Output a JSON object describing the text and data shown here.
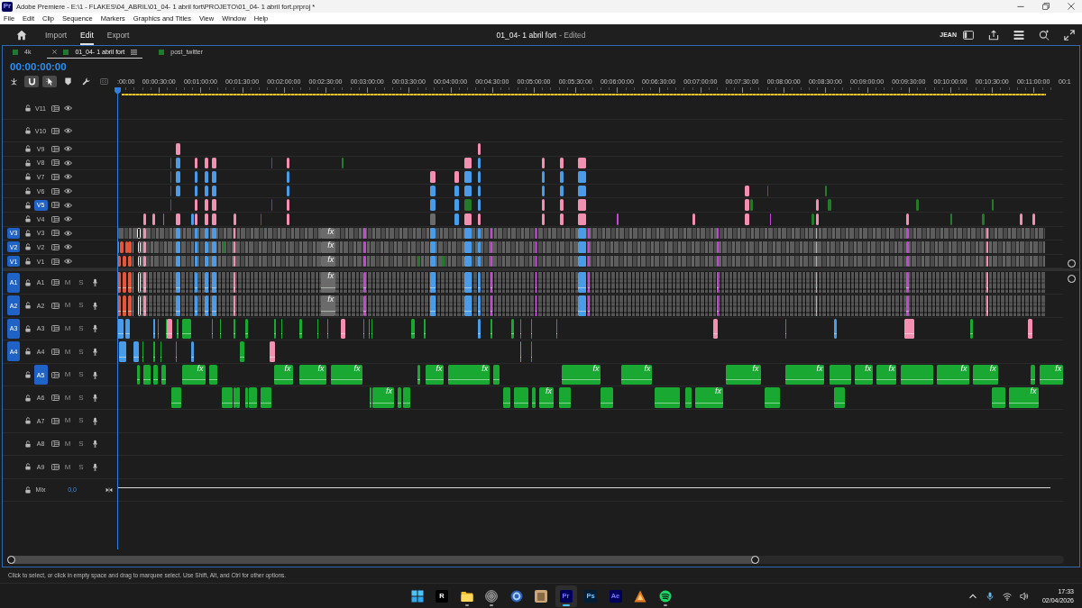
{
  "window": {
    "app_icon": "Pr",
    "title": "Adobe Premiere - E:\\1 - FLAKES\\04_ABRIL\\01_04- 1 abril fort\\PROJETO\\01_04- 1 abril fort.prproj *"
  },
  "menu": [
    "File",
    "Edit",
    "Clip",
    "Sequence",
    "Markers",
    "Graphics and Titles",
    "View",
    "Window",
    "Help"
  ],
  "header": {
    "tabs": [
      {
        "label": "Import",
        "selected": false
      },
      {
        "label": "Edit",
        "selected": true
      },
      {
        "label": "Export",
        "selected": false
      }
    ],
    "project": "01_04- 1 abril fort",
    "status": "- Edited",
    "workspace": "JEAN"
  },
  "sequence_tabs": [
    {
      "label": "4k",
      "selected": false
    },
    {
      "label": "01_04- 1 abril fort",
      "selected": true
    },
    {
      "label": "post_twitter",
      "selected": false
    }
  ],
  "timecode": "00:00:00:00",
  "tools": [
    {
      "kind": "nest",
      "on": false
    },
    {
      "kind": "snap",
      "on": true
    },
    {
      "kind": "linked",
      "on": true
    },
    {
      "kind": "marker",
      "on": false
    },
    {
      "kind": "wrench",
      "on": false
    },
    {
      "kind": "captions",
      "on": false
    }
  ],
  "ruler": {
    "labels": [
      ":00:00",
      "00:00:30:00",
      "00:01:00:00",
      "00:01:30:00",
      "00:02:00:00",
      "00:02:30:00",
      "00:03:00:00",
      "00:03:30:00",
      "00:04:00:00",
      "00:04:30:00",
      "00:05:00:00",
      "00:05:30:00",
      "00:06:00:00",
      "00:06:30:00",
      "00:07:00:00",
      "00:07:30:00",
      "00:08:00:00",
      "00:08:30:00",
      "00:09:00:00",
      "00:09:30:00",
      "00:10:00:00",
      "00:10:30:00",
      "00:11:00:00",
      "00:1"
    ]
  },
  "video_tracks": [
    {
      "name": "V11",
      "expanded": true,
      "targeted": false,
      "locked": false,
      "visible": true
    },
    {
      "name": "V10",
      "expanded": true,
      "targeted": false,
      "locked": false,
      "visible": true
    },
    {
      "name": "V9",
      "expanded": false,
      "targeted": false,
      "locked": false,
      "visible": true,
      "clips": [
        {
          "kind": "clip",
          "color": "#f48fb1"
        },
        {
          "kind": "clip",
          "color": "#f48fb1"
        }
      ]
    },
    {
      "name": "V8",
      "expanded": false,
      "targeted": false,
      "locked": false,
      "visible": true,
      "clips": [
        {
          "kind": "clip",
          "color": "#237a2a"
        },
        {
          "kind": "clip",
          "color": "#4a9be8"
        },
        {
          "kind": "clip",
          "color": "#f48fb1"
        },
        {
          "kind": "clip",
          "color": "#f48fb1"
        },
        {
          "kind": "clip",
          "color": "#f48fb1"
        },
        {
          "kind": "clip",
          "color": "#237a2a"
        },
        {
          "kind": "clip",
          "color": "#f48fb1"
        },
        {
          "kind": "clip",
          "color": "#237a2a"
        },
        {
          "kind": "clip",
          "color": "#f48fb1"
        },
        {
          "kind": "clip",
          "color": "#4a9be8"
        },
        {
          "kind": "clip",
          "color": "#f48fb1"
        },
        {
          "kind": "clip",
          "color": "#f48fb1"
        },
        {
          "kind": "clip",
          "color": "#f48fb1"
        }
      ]
    },
    {
      "name": "V7",
      "expanded": false,
      "targeted": false,
      "locked": false,
      "visible": true,
      "clips": [
        {
          "kind": "clip",
          "color": "#237a2a"
        },
        {
          "kind": "clip",
          "color": "#4a9be8"
        },
        {
          "kind": "clip",
          "color": "#4a9be8"
        },
        {
          "kind": "clip",
          "color": "#4a9be8"
        },
        {
          "kind": "clip",
          "color": "#4a9be8"
        },
        {
          "kind": "clip",
          "color": "#4a9be8"
        },
        {
          "kind": "clip",
          "color": "#f48fb1"
        },
        {
          "kind": "clip",
          "color": "#f48fb1"
        },
        {
          "kind": "clip",
          "color": "#4a9be8"
        },
        {
          "kind": "clip",
          "color": "#4a9be8"
        },
        {
          "kind": "clip",
          "color": "#4a9be8"
        },
        {
          "kind": "clip",
          "color": "#4a9be8"
        },
        {
          "kind": "clip",
          "color": "#4a9be8"
        }
      ]
    },
    {
      "name": "V6",
      "expanded": false,
      "targeted": false,
      "locked": false,
      "visible": true,
      "clips": [
        {
          "kind": "clip",
          "color": "#237a2a"
        },
        {
          "kind": "clip",
          "color": "#4a9be8"
        },
        {
          "kind": "clip",
          "color": "#4a9be8"
        },
        {
          "kind": "clip",
          "color": "#4a9be8"
        },
        {
          "kind": "clip",
          "color": "#4a9be8"
        },
        {
          "kind": "clip",
          "color": "#4a9be8"
        },
        {
          "kind": "clip",
          "color": "#4a9be8"
        },
        {
          "kind": "clip",
          "color": "#4a9be8"
        },
        {
          "kind": "clip",
          "color": "#4a9be8"
        },
        {
          "kind": "clip",
          "color": "#4a9be8"
        },
        {
          "kind": "clip",
          "color": "#4a9be8"
        },
        {
          "kind": "clip",
          "color": "#4a9be8"
        },
        {
          "kind": "clip",
          "color": "#4a9be8"
        },
        {
          "kind": "clip",
          "color": "#f48fb1"
        },
        {
          "kind": "clip",
          "color": "#237a2a"
        },
        {
          "kind": "clip",
          "color": "#237a2a"
        }
      ]
    },
    {
      "name": "V5",
      "expanded": false,
      "targeted": true,
      "locked": false,
      "visible": true,
      "clips": [
        {
          "kind": "clip",
          "color": "#237a2a"
        },
        {
          "kind": "clip",
          "color": "#f48fb1"
        },
        {
          "kind": "clip",
          "color": "#f48fb1"
        },
        {
          "kind": "clip",
          "color": "#f48fb1"
        },
        {
          "kind": "clip",
          "color": "#237a2a"
        },
        {
          "kind": "clip",
          "color": "#f48fb1"
        },
        {
          "kind": "clip",
          "color": "#4a9be8"
        },
        {
          "kind": "clip",
          "color": "#4a9be8"
        },
        {
          "kind": "clip",
          "color": "#237a2a"
        },
        {
          "kind": "clip",
          "color": "#4a9be8"
        },
        {
          "kind": "clip",
          "color": "#f48fb1"
        },
        {
          "kind": "clip",
          "color": "#f48fb1"
        },
        {
          "kind": "clip",
          "color": "#f48fb1"
        },
        {
          "kind": "clip",
          "color": "#f48fb1"
        },
        {
          "kind": "clip",
          "color": "#237a2a"
        },
        {
          "kind": "clip",
          "color": "#f48fb1"
        },
        {
          "kind": "clip",
          "color": "#237a2a"
        },
        {
          "kind": "clip",
          "color": "#237a2a"
        },
        {
          "kind": "clip",
          "color": "#237a2a"
        }
      ]
    },
    {
      "name": "V4",
      "expanded": false,
      "targeted": false,
      "locked": false,
      "visible": true,
      "clips": [
        {
          "kind": "clip",
          "color": "#f48fb1"
        },
        {
          "kind": "clip",
          "color": "#f48fb1"
        },
        {
          "kind": "clip",
          "color": "#c646d6"
        },
        {
          "kind": "clip",
          "color": "#f48fb1"
        },
        {
          "kind": "clip",
          "color": "#4a9be8"
        },
        {
          "kind": "clip",
          "color": "#f48fb1"
        },
        {
          "kind": "clip",
          "color": "#f48fb1"
        },
        {
          "kind": "clip",
          "color": "#f48fb1"
        },
        {
          "kind": "clip",
          "color": "#f48fb1"
        },
        {
          "kind": "clip",
          "color": "#237a2a"
        },
        {
          "kind": "clip",
          "color": "#f48fb1"
        },
        {
          "kind": "clip",
          "color": "#6b6b6b"
        },
        {
          "kind": "clip",
          "color": "#4a9be8"
        },
        {
          "kind": "clip",
          "color": "#f48fb1"
        },
        {
          "kind": "clip",
          "color": "#f48fb1"
        },
        {
          "kind": "clip",
          "color": "#f48fb1"
        },
        {
          "kind": "clip",
          "color": "#f48fb1"
        },
        {
          "kind": "clip",
          "color": "#f48fb1"
        },
        {
          "kind": "clip",
          "color": "#c646d6"
        },
        {
          "kind": "clip",
          "color": "#f48fb1"
        },
        {
          "kind": "clip",
          "color": "#f48fb1"
        },
        {
          "kind": "clip",
          "color": "#c646d6"
        },
        {
          "kind": "clip",
          "color": "#237a2a"
        },
        {
          "kind": "clip",
          "color": "#f48fb1"
        },
        {
          "kind": "clip",
          "color": "#f48fb1"
        },
        {
          "kind": "clip",
          "color": "#237a2a"
        },
        {
          "kind": "clip",
          "color": "#237a2a"
        },
        {
          "kind": "clip",
          "color": "#f48fb1"
        },
        {
          "kind": "clip",
          "color": "#f48fb1"
        }
      ]
    },
    {
      "name": "V3",
      "source": "V3",
      "expanded": false,
      "targeted": false,
      "locked": false,
      "visible": true,
      "clips": [
        {
          "kind": "clip",
          "color": "#237a2a"
        },
        {
          "kind": "run"
        },
        {
          "kind": "outline"
        },
        {
          "kind": "clip",
          "color": "#f48fb1"
        },
        {
          "kind": "clip",
          "color": "#4a9be8"
        },
        {
          "kind": "clip",
          "color": "#4a9be8"
        },
        {
          "kind": "clip",
          "color": "#4a9be8"
        },
        {
          "kind": "clip",
          "color": "#4a9be8"
        },
        {
          "kind": "clip",
          "color": "#f48fb1"
        },
        {
          "kind": "clip",
          "color": "#6b6b6b",
          "label": "fx"
        },
        {
          "kind": "clip",
          "color": "#c646d6"
        },
        {
          "kind": "clip",
          "color": "#4a9be8"
        },
        {
          "kind": "clip",
          "color": "#4a9be8"
        },
        {
          "kind": "clip",
          "color": "#4a9be8"
        },
        {
          "kind": "clip",
          "color": "#c646d6"
        },
        {
          "kind": "clip",
          "color": "#c646d6"
        },
        {
          "kind": "clip",
          "color": "#4a9be8"
        },
        {
          "kind": "clip",
          "color": "#c646d6"
        },
        {
          "kind": "clip",
          "color": "#c646d6"
        },
        {
          "kind": "clip",
          "color": "#f48fb1"
        },
        {
          "kind": "clip",
          "color": "#c646d6"
        },
        {
          "kind": "clip",
          "color": "#f48fb1"
        }
      ]
    },
    {
      "name": "V2",
      "source": "V2",
      "expanded": false,
      "targeted": false,
      "locked": false,
      "visible": true,
      "clips": [
        {
          "kind": "clip",
          "color": "#c646d6"
        },
        {
          "kind": "clip",
          "color": "#e8543a"
        },
        {
          "kind": "clip",
          "color": "#e8543a"
        },
        {
          "kind": "clip",
          "color": "#e8543a"
        },
        {
          "kind": "clip",
          "color": "#4a9be8"
        },
        {
          "kind": "outline"
        },
        {
          "kind": "run"
        },
        {
          "kind": "clip",
          "color": "#f48fb1"
        },
        {
          "kind": "clip",
          "color": "#4a9be8"
        },
        {
          "kind": "clip",
          "color": "#4a9be8"
        },
        {
          "kind": "clip",
          "color": "#4a9be8"
        },
        {
          "kind": "clip",
          "color": "#4a9be8"
        },
        {
          "kind": "clip",
          "color": "#237a2a"
        },
        {
          "kind": "clip",
          "color": "#f48fb1"
        },
        {
          "kind": "clip",
          "color": "#6b6b6b",
          "label": "fx"
        },
        {
          "kind": "clip",
          "color": "#c646d6"
        },
        {
          "kind": "clip",
          "color": "#4a9be8"
        },
        {
          "kind": "clip",
          "color": "#4a9be8"
        },
        {
          "kind": "clip",
          "color": "#4a9be8"
        },
        {
          "kind": "clip",
          "color": "#c646d6"
        },
        {
          "kind": "clip",
          "color": "#c646d6"
        },
        {
          "kind": "clip",
          "color": "#4a9be8"
        },
        {
          "kind": "clip",
          "color": "#c646d6"
        },
        {
          "kind": "clip",
          "color": "#c646d6"
        },
        {
          "kind": "clip",
          "color": "#f48fb1"
        },
        {
          "kind": "clip",
          "color": "#c646d6"
        },
        {
          "kind": "clip",
          "color": "#f48fb1"
        }
      ]
    },
    {
      "name": "V1",
      "source": "V1",
      "expanded": false,
      "targeted": false,
      "locked": false,
      "visible": true,
      "clips": [
        {
          "kind": "clip",
          "color": "#e8543a"
        },
        {
          "kind": "clip",
          "color": "#e8543a"
        },
        {
          "kind": "clip",
          "color": "#e8543a"
        },
        {
          "kind": "clip",
          "color": "#4a9be8"
        },
        {
          "kind": "outline"
        },
        {
          "kind": "run"
        },
        {
          "kind": "clip",
          "color": "#f48fb1"
        },
        {
          "kind": "clip",
          "color": "#4a9be8"
        },
        {
          "kind": "clip",
          "color": "#4a9be8"
        },
        {
          "kind": "clip",
          "color": "#4a9be8"
        },
        {
          "kind": "clip",
          "color": "#4a9be8"
        },
        {
          "kind": "clip",
          "color": "#f48fb1"
        },
        {
          "kind": "clip",
          "color": "#6b6b6b",
          "label": "fx"
        },
        {
          "kind": "clip",
          "color": "#c646d6"
        },
        {
          "kind": "clip",
          "color": "#237a2a"
        },
        {
          "kind": "clip",
          "color": "#237a2a"
        },
        {
          "kind": "clip",
          "color": "#4a9be8"
        },
        {
          "kind": "clip",
          "color": "#237a2a"
        },
        {
          "kind": "clip",
          "color": "#4a9be8"
        },
        {
          "kind": "clip",
          "color": "#4a9be8"
        },
        {
          "kind": "clip",
          "color": "#c646d6"
        },
        {
          "kind": "clip",
          "color": "#c646d6"
        },
        {
          "kind": "clip",
          "color": "#4a9be8"
        },
        {
          "kind": "clip",
          "color": "#c646d6"
        },
        {
          "kind": "clip",
          "color": "#c646d6"
        },
        {
          "kind": "clip",
          "color": "#f48fb1"
        },
        {
          "kind": "clip",
          "color": "#c646d6"
        },
        {
          "kind": "clip",
          "color": "#f48fb1"
        }
      ]
    }
  ],
  "audio_tracks": [
    {
      "name": "A1",
      "source": "A1",
      "targeted": false,
      "locked": false,
      "mute": "M",
      "solo": "S",
      "muted": false,
      "soloed": false,
      "clips": [
        {
          "kind": "clip",
          "color": "#e8543a"
        },
        {
          "kind": "clip",
          "color": "#e8543a"
        },
        {
          "kind": "clip",
          "color": "#e8543a"
        },
        {
          "kind": "clip",
          "color": "#4a9be8"
        },
        {
          "kind": "outline"
        },
        {
          "kind": "wave"
        },
        {
          "kind": "clip",
          "color": "#f48fb1"
        },
        {
          "kind": "clip",
          "color": "#4a9be8"
        },
        {
          "kind": "clip",
          "color": "#4a9be8"
        },
        {
          "kind": "clip",
          "color": "#4a9be8"
        },
        {
          "kind": "clip",
          "color": "#4a9be8"
        },
        {
          "kind": "clip",
          "color": "#f48fb1"
        },
        {
          "kind": "clip",
          "color": "#6b6b6b",
          "label": "fx"
        },
        {
          "kind": "clip",
          "color": "#c646d6"
        },
        {
          "kind": "clip",
          "color": "#4a9be8"
        },
        {
          "kind": "clip",
          "color": "#4a9be8"
        },
        {
          "kind": "clip",
          "color": "#4a9be8"
        },
        {
          "kind": "clip",
          "color": "#c646d6"
        },
        {
          "kind": "clip",
          "color": "#c646d6"
        },
        {
          "kind": "clip",
          "color": "#4a9be8"
        },
        {
          "kind": "clip",
          "color": "#c646d6"
        },
        {
          "kind": "clip",
          "color": "#c646d6"
        },
        {
          "kind": "clip",
          "color": "#f48fb1"
        },
        {
          "kind": "clip",
          "color": "#c646d6"
        },
        {
          "kind": "clip",
          "color": "#f48fb1"
        }
      ]
    },
    {
      "name": "A2",
      "source": "A2",
      "targeted": false,
      "locked": false,
      "mute": "M",
      "solo": "S",
      "muted": false,
      "soloed": false,
      "clips": [
        {
          "kind": "clip",
          "color": "#e8543a"
        },
        {
          "kind": "clip",
          "color": "#e8543a"
        },
        {
          "kind": "clip",
          "color": "#e8543a"
        },
        {
          "kind": "clip",
          "color": "#4a9be8"
        },
        {
          "kind": "outline"
        },
        {
          "kind": "wave"
        },
        {
          "kind": "clip",
          "color": "#f48fb1"
        },
        {
          "kind": "clip",
          "color": "#4a9be8"
        },
        {
          "kind": "clip",
          "color": "#4a9be8"
        },
        {
          "kind": "clip",
          "color": "#4a9be8"
        },
        {
          "kind": "clip",
          "color": "#4a9be8"
        },
        {
          "kind": "clip",
          "color": "#f48fb1"
        },
        {
          "kind": "clip",
          "color": "#6b6b6b",
          "label": "fx"
        },
        {
          "kind": "clip",
          "color": "#c646d6"
        },
        {
          "kind": "clip",
          "color": "#4a9be8"
        },
        {
          "kind": "clip",
          "color": "#4a9be8"
        },
        {
          "kind": "clip",
          "color": "#4a9be8"
        },
        {
          "kind": "clip",
          "color": "#c646d6"
        },
        {
          "kind": "clip",
          "color": "#c646d6"
        },
        {
          "kind": "clip",
          "color": "#4a9be8"
        },
        {
          "kind": "clip",
          "color": "#c646d6"
        },
        {
          "kind": "clip",
          "color": "#c646d6"
        },
        {
          "kind": "clip",
          "color": "#f48fb1"
        },
        {
          "kind": "clip",
          "color": "#c646d6"
        },
        {
          "kind": "clip",
          "color": "#f48fb1"
        }
      ]
    },
    {
      "name": "A3",
      "source": "A3",
      "targeted": false,
      "locked": false,
      "mute": "M",
      "solo": "S",
      "muted": false,
      "soloed": false,
      "clips": [
        {
          "kind": "clip",
          "color": "#4a9be8"
        },
        {
          "kind": "clip",
          "color": "#4a9be8"
        },
        {
          "kind": "clip",
          "color": "#4a9be8"
        },
        {
          "kind": "clip",
          "color": "#19a832"
        },
        {
          "kind": "clip",
          "color": "#19a832"
        },
        {
          "kind": "clip",
          "color": "#f48fb1"
        },
        {
          "kind": "clip",
          "color": "#19a832"
        },
        {
          "kind": "clip",
          "color": "#19a832"
        },
        {
          "kind": "clip",
          "color": "#19a832"
        },
        {
          "kind": "clip",
          "color": "#19a832"
        },
        {
          "kind": "clip",
          "color": "#19a832"
        },
        {
          "kind": "clip",
          "color": "#19a832"
        },
        {
          "kind": "clip",
          "color": "#19a832"
        },
        {
          "kind": "clip",
          "color": "#19a832"
        },
        {
          "kind": "clip",
          "color": "#19a832"
        },
        {
          "kind": "clip",
          "color": "#19a832"
        },
        {
          "kind": "clip",
          "color": "#19a832"
        },
        {
          "kind": "clip",
          "color": "#f48fb1"
        },
        {
          "kind": "clip",
          "color": "#19a832"
        },
        {
          "kind": "clip",
          "color": "#19a832"
        },
        {
          "kind": "clip",
          "color": "#19a832"
        },
        {
          "kind": "clip",
          "color": "#19a832"
        },
        {
          "kind": "clip",
          "color": "#19a832"
        },
        {
          "kind": "clip",
          "color": "#4a9be8"
        },
        {
          "kind": "clip",
          "color": "#19a832"
        },
        {
          "kind": "clip",
          "color": "#19a832"
        },
        {
          "kind": "clip",
          "color": "#19a832"
        },
        {
          "kind": "clip",
          "color": "#19a832"
        },
        {
          "kind": "clip",
          "color": "#19a832"
        },
        {
          "kind": "clip",
          "color": "#f48fb1"
        },
        {
          "kind": "clip",
          "color": "#19a832"
        },
        {
          "kind": "clip",
          "color": "#4a9be8"
        },
        {
          "kind": "clip",
          "color": "#f48fb1"
        },
        {
          "kind": "clip",
          "color": "#19a832"
        },
        {
          "kind": "clip",
          "color": "#f48fb1"
        }
      ]
    },
    {
      "name": "A4",
      "source": "A4",
      "targeted": false,
      "locked": false,
      "mute": "M",
      "solo": "S",
      "muted": false,
      "soloed": false,
      "clips": [
        {
          "kind": "clip",
          "color": "#4a9be8"
        },
        {
          "kind": "clip",
          "color": "#4a9be8"
        },
        {
          "kind": "clip",
          "color": "#19a832"
        },
        {
          "kind": "clip",
          "color": "#19a832"
        },
        {
          "kind": "clip",
          "color": "#19a832"
        },
        {
          "kind": "clip",
          "color": "#19a832"
        },
        {
          "kind": "clip",
          "color": "#4a9be8"
        },
        {
          "kind": "clip",
          "color": "#19a832"
        },
        {
          "kind": "clip",
          "color": "#f48fb1"
        },
        {
          "kind": "clip",
          "color": "#4a9be8"
        },
        {
          "kind": "clip",
          "color": "#19a832"
        }
      ]
    },
    {
      "name": "A5",
      "targeted": true,
      "locked": false,
      "mute": "M",
      "solo": "S",
      "muted": false,
      "soloed": false,
      "clips": [
        {
          "kind": "clip",
          "color": "#19a832"
        },
        {
          "kind": "clip",
          "color": "#19a832"
        },
        {
          "kind": "clip",
          "color": "#19a832"
        },
        {
          "kind": "clip",
          "color": "#19a832"
        },
        {
          "kind": "clip",
          "color": "#19a832",
          "label": "fx"
        },
        {
          "kind": "clip",
          "color": "#19a832"
        },
        {
          "kind": "clip",
          "color": "#19a832",
          "label": "fx"
        },
        {
          "kind": "clip",
          "color": "#19a832",
          "label": "fx"
        },
        {
          "kind": "clip",
          "color": "#19a832",
          "label": "fx"
        },
        {
          "kind": "clip",
          "color": "#19a832"
        },
        {
          "kind": "clip",
          "color": "#19a832",
          "label": "fx"
        },
        {
          "kind": "clip",
          "color": "#19a832",
          "label": "fx"
        },
        {
          "kind": "clip",
          "color": "#19a832"
        },
        {
          "kind": "clip",
          "color": "#19a832",
          "label": "fx"
        },
        {
          "kind": "clip",
          "color": "#19a832",
          "label": "fx"
        },
        {
          "kind": "clip",
          "color": "#19a832",
          "label": "fx"
        },
        {
          "kind": "clip",
          "color": "#19a832",
          "label": "fx"
        },
        {
          "kind": "clip",
          "color": "#19a832"
        },
        {
          "kind": "clip",
          "color": "#19a832",
          "label": "fx"
        },
        {
          "kind": "clip",
          "color": "#19a832",
          "label": "fx"
        },
        {
          "kind": "clip",
          "color": "#19a832"
        },
        {
          "kind": "clip",
          "color": "#19a832",
          "label": "fx"
        },
        {
          "kind": "clip",
          "color": "#19a832",
          "label": "fx"
        },
        {
          "kind": "clip",
          "color": "#19a832"
        },
        {
          "kind": "clip",
          "color": "#19a832",
          "label": "fx"
        }
      ]
    },
    {
      "name": "A6",
      "targeted": false,
      "locked": false,
      "mute": "M",
      "solo": "S",
      "muted": false,
      "soloed": false,
      "clips": [
        {
          "kind": "clip",
          "color": "#19a832"
        },
        {
          "kind": "clip",
          "color": "#19a832"
        },
        {
          "kind": "clip",
          "color": "#19a832"
        },
        {
          "kind": "clip",
          "color": "#19a832"
        },
        {
          "kind": "clip",
          "color": "#19a832"
        },
        {
          "kind": "clip",
          "color": "#19a832"
        },
        {
          "kind": "clip",
          "color": "#19a832"
        },
        {
          "kind": "clip",
          "color": "#19a832"
        },
        {
          "kind": "clip",
          "color": "#19a832",
          "label": "fx"
        },
        {
          "kind": "clip",
          "color": "#19a832"
        },
        {
          "kind": "clip",
          "color": "#19a832"
        },
        {
          "kind": "clip",
          "color": "#19a832"
        },
        {
          "kind": "clip",
          "color": "#19a832"
        },
        {
          "kind": "clip",
          "color": "#19a832"
        },
        {
          "kind": "clip",
          "color": "#19a832",
          "label": "fx"
        },
        {
          "kind": "clip",
          "color": "#19a832"
        },
        {
          "kind": "clip",
          "color": "#19a832"
        },
        {
          "kind": "clip",
          "color": "#19a832"
        },
        {
          "kind": "clip",
          "color": "#19a832"
        },
        {
          "kind": "clip",
          "color": "#19a832",
          "label": "fx"
        },
        {
          "kind": "clip",
          "color": "#19a832"
        },
        {
          "kind": "clip",
          "color": "#19a832"
        },
        {
          "kind": "clip",
          "color": "#19a832"
        },
        {
          "kind": "clip",
          "color": "#19a832",
          "label": "fx"
        }
      ]
    },
    {
      "name": "A7",
      "targeted": false,
      "locked": false,
      "mute": "M",
      "solo": "S",
      "muted": false,
      "soloed": false
    },
    {
      "name": "A8",
      "targeted": false,
      "locked": false,
      "mute": "M",
      "solo": "S",
      "muted": false,
      "soloed": false
    },
    {
      "name": "A9",
      "targeted": false,
      "locked": false,
      "mute": "M",
      "solo": "S",
      "muted": false,
      "soloed": false
    }
  ],
  "mix": {
    "name": "Mix",
    "value": "0,0",
    "locked": false
  },
  "status": "Click to select, or click in empty space and drag to marquee select. Use Shift, Alt, and Ctrl for other options.",
  "taskbar": {
    "apps": [
      {
        "kind": "start",
        "running": false,
        "selected": false
      },
      {
        "kind": "tile",
        "label": "R",
        "color": "#000000",
        "running": false,
        "selected": false
      },
      {
        "kind": "folder",
        "running": true,
        "selected": false
      },
      {
        "kind": "disc",
        "running": true,
        "selected": false
      },
      {
        "kind": "ring",
        "running": false,
        "selected": false
      },
      {
        "kind": "picture",
        "running": false,
        "selected": false
      },
      {
        "kind": "tile",
        "label": "Pr",
        "color": "#00005b",
        "running": true,
        "selected": true
      },
      {
        "kind": "tile",
        "label": "Ps",
        "color": "#001e36",
        "running": false,
        "selected": false
      },
      {
        "kind": "tile",
        "label": "Ae",
        "color": "#00005b",
        "running": false,
        "selected": false
      },
      {
        "kind": "emblem",
        "running": false,
        "selected": false
      },
      {
        "kind": "waves",
        "running": true,
        "selected": false
      }
    ],
    "time": "17:33",
    "date": "02/04/2026"
  }
}
